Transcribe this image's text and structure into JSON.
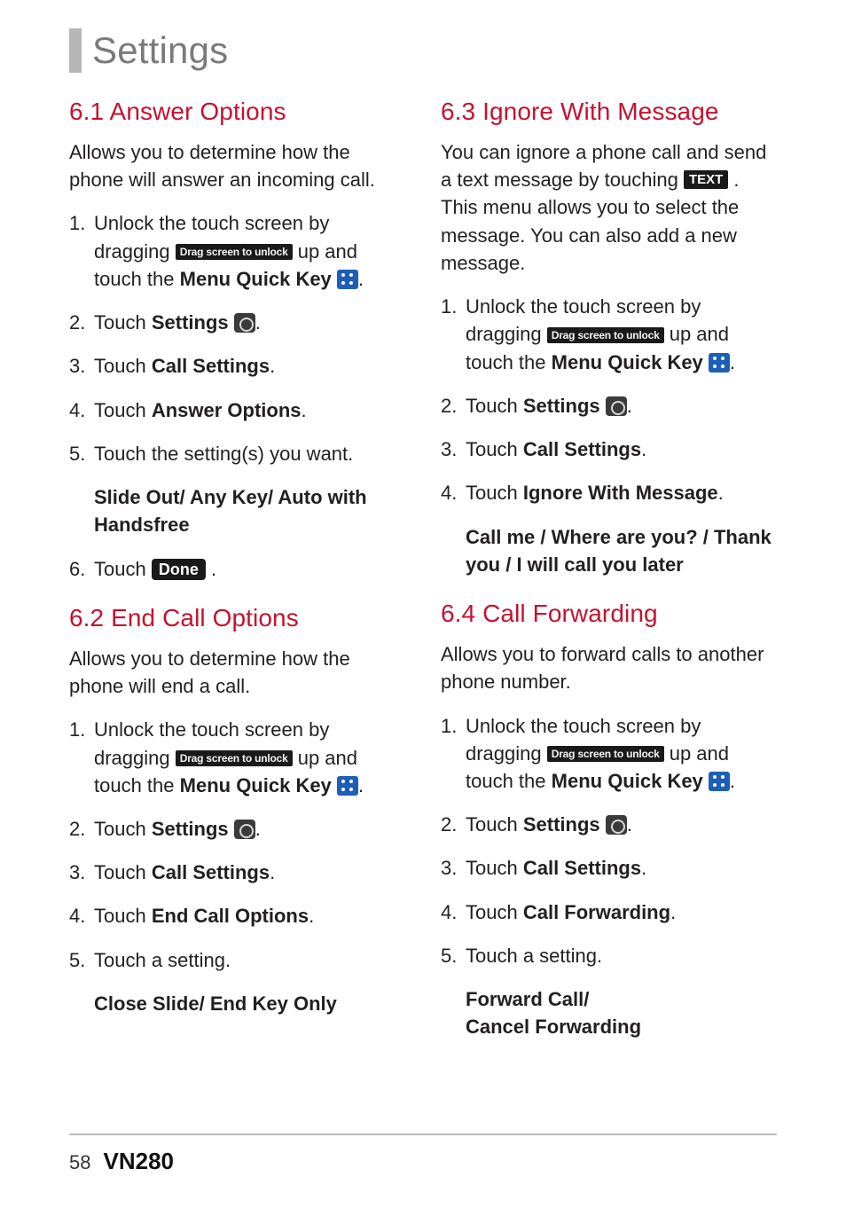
{
  "page_title": "Settings",
  "footer": {
    "page_number": "58",
    "model": "VN280"
  },
  "icons": {
    "drag_unlock": "Drag screen to unlock",
    "text_btn": "TEXT",
    "done_btn": "Done"
  },
  "common": {
    "unlock_a": "Unlock the touch screen by dragging ",
    "unlock_b": " up and touch the ",
    "menu_quick_key": "Menu Quick Key",
    "touch": "Touch ",
    "settings_label": "Settings",
    "call_settings": "Call Settings",
    "period": "."
  },
  "left": {
    "s61": {
      "heading": "6.1 Answer Options",
      "intro": "Allows you to determine how the phone will answer an incoming call.",
      "step4_label": "Answer Options",
      "step5": "Touch the setting(s) you want.",
      "options": "Slide Out/ Any Key/ Auto with Handsfree",
      "step6_a": "Touch ",
      "step6_b": " ."
    },
    "s62": {
      "heading": "6.2 End Call Options",
      "intro": "Allows you to determine how the phone will end a call.",
      "step4_label": "End Call Options",
      "step5": "Touch a setting.",
      "options": "Close Slide/ End Key Only"
    }
  },
  "right": {
    "s63": {
      "heading": "6.3 Ignore With Message",
      "intro_a": "You can ignore a phone call and send a text message by touching ",
      "intro_b": " . This menu allows you to select the message. You can also add a new message.",
      "step4_label": "Ignore With Message",
      "options": "Call me / Where are you? / Thank you / I will call you later"
    },
    "s64": {
      "heading": "6.4 Call Forwarding",
      "intro": "Allows you to forward calls to another phone number.",
      "step4_label": "Call Forwarding",
      "step5": "Touch a setting.",
      "options": "Forward Call/\nCancel Forwarding"
    }
  }
}
